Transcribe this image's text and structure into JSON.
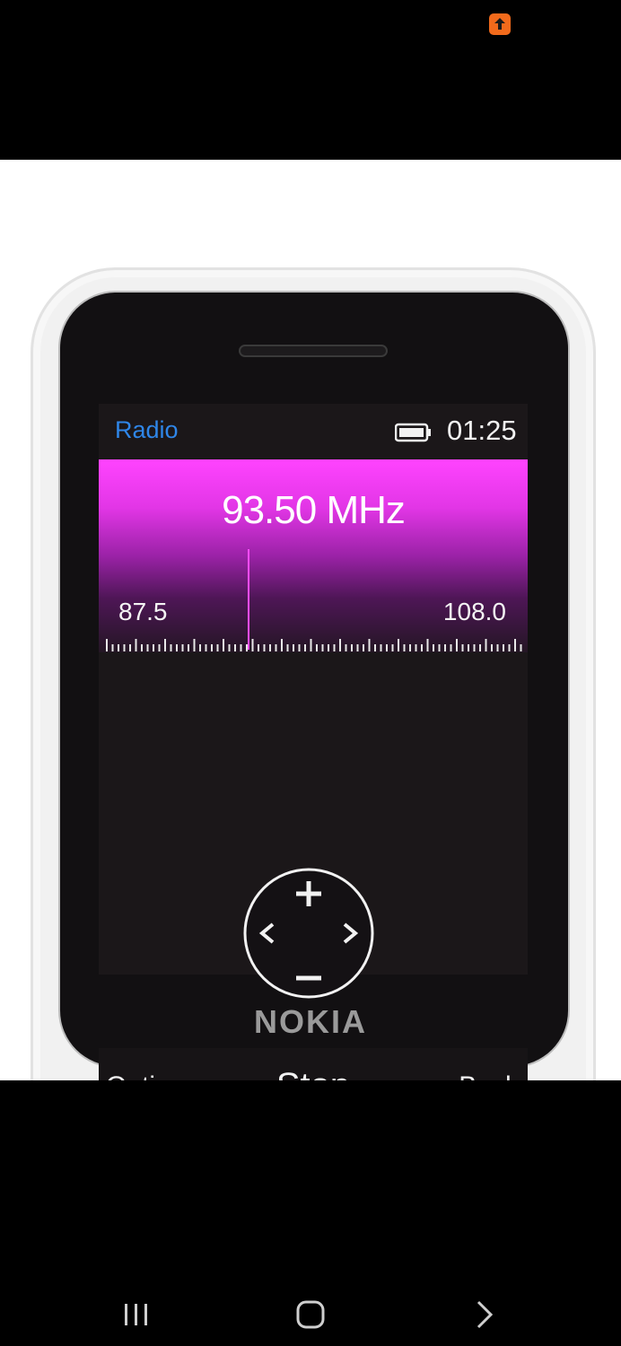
{
  "phone_screen": {
    "app_title": "Radio",
    "clock": "01:25",
    "frequency": "93.50 MHz",
    "band_min": "87.5",
    "band_max": "108.0",
    "softkeys": {
      "left": "Options",
      "center": "Stop",
      "right": "Back"
    }
  },
  "brand": "NOKIA",
  "colors": {
    "accent_title": "#2f86e8",
    "tuner_magenta": "#ff43ff",
    "notification": "#f26a1b"
  },
  "icons": {
    "notification": "upload-arrow-icon",
    "battery": "battery-icon",
    "dpad": "navigation-dpad-icon",
    "nav_recents": "recents-icon",
    "nav_home": "home-icon",
    "nav_back": "back-chevron-icon"
  }
}
